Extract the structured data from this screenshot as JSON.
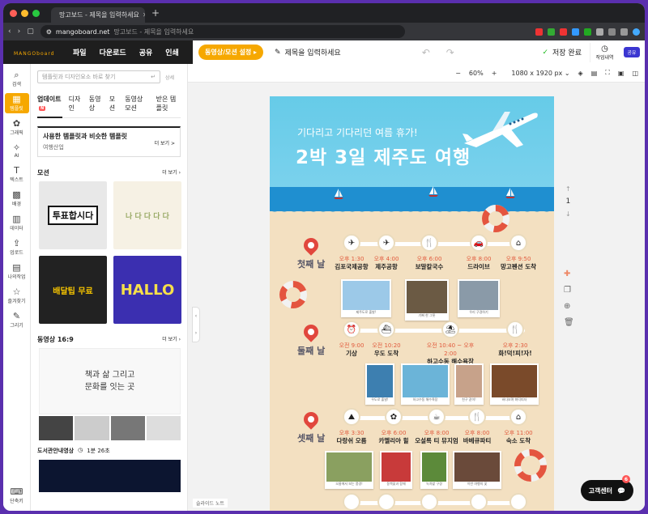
{
  "browser": {
    "tab_title": "망고보드 - 제목을 입력하세요",
    "url_domain": "mangoboard.net",
    "url_rest": "망고보드 - 제목을 입력하세요"
  },
  "header": {
    "logo": "MANGO",
    "logo_sub": "board",
    "menu": [
      "파일",
      "다운로드",
      "공유",
      "인쇄"
    ],
    "video_button": "동영상/모션 설정",
    "title_placeholder": "제목을 입력하세요",
    "saved": "저장 완료",
    "history": "작업내역",
    "share": "공유"
  },
  "rail": [
    {
      "icon": "search-icon",
      "glyph": "⌕",
      "label": "검색"
    },
    {
      "icon": "template-icon",
      "glyph": "▦",
      "label": "템플릿"
    },
    {
      "icon": "graphic-icon",
      "glyph": "✿",
      "label": "그래픽"
    },
    {
      "icon": "ai-icon",
      "glyph": "✧",
      "label": "AI"
    },
    {
      "icon": "text-icon",
      "glyph": "T",
      "label": "텍스트"
    },
    {
      "icon": "background-icon",
      "glyph": "▩",
      "label": "배경"
    },
    {
      "icon": "data-icon",
      "glyph": "▥",
      "label": "데이터"
    },
    {
      "icon": "upload-icon",
      "glyph": "⇪",
      "label": "업로드"
    },
    {
      "icon": "my-work-icon",
      "glyph": "▤",
      "label": "나의작업"
    },
    {
      "icon": "favorite-icon",
      "glyph": "☆",
      "label": "즐겨찾기"
    },
    {
      "icon": "draw-icon",
      "glyph": "✎",
      "label": "그리기"
    }
  ],
  "rail_bottom": "단축키",
  "panel": {
    "search_placeholder": "템플릿과 디자인요소 바로 찾기",
    "search_detail": "상세",
    "tabs": [
      "업데이트",
      "디자인",
      "동영상",
      "모션",
      "동영상 모션",
      "받은 템플릿"
    ],
    "update_badge": "N",
    "recommend_title": "사용한 템플릿과 비슷한 템플릿",
    "recommend_sub": "여행산업",
    "more": "더 보기 >",
    "motion_title": "모션",
    "motion_more": "더 보기",
    "motion_items": [
      "투표합시다",
      "나 다 다 다 다",
      "배달팁 무료",
      "HALLO"
    ],
    "video_title": "동영상 16:9",
    "video_more": "더 보기",
    "video_text1": "책과 삶 그리고",
    "video_text2": "문화를 잇는 곳",
    "clip_title": "도서관안내영상",
    "clip_dur": "1분 26초"
  },
  "toolbar": {
    "zoom": "60%",
    "size": "1080 x 1920 px"
  },
  "canvas": {
    "subtitle": "기다리고 기다리던 여름 휴가!",
    "title": "2박 3일 제주도 여행",
    "days": [
      "첫째 날",
      "둘째 날",
      "셋째 날"
    ],
    "day1": [
      {
        "time": "오후 1:30",
        "name": "김포국제공항"
      },
      {
        "time": "오후 4:00",
        "name": "제주공항"
      },
      {
        "time": "오후 6:00",
        "name": "보말칼국수"
      },
      {
        "time": "오후 8:00",
        "name": "드라이브"
      },
      {
        "time": "오후 9:50",
        "name": "망고펜션 도착"
      }
    ],
    "day2": [
      {
        "time": "오전 9:00",
        "name": "기상"
      },
      {
        "time": "오전 10:20",
        "name": "우도 도착"
      },
      {
        "time": "오전 10:40 ~ 오후 2:00",
        "name": "하고수동 해수욕장"
      },
      {
        "time": "오후 2:30",
        "name": "화!덕!피!자!"
      }
    ],
    "day3": [
      {
        "time": "오후 3:30",
        "name": "다랑쉬 오름"
      },
      {
        "time": "오후 6:00",
        "name": "카멜리아 힐"
      },
      {
        "time": "오후 8:00",
        "name": "오설록 티 뮤지엄"
      },
      {
        "time": "오후 8:00",
        "name": "바베큐파티"
      },
      {
        "time": "오후 11:00",
        "name": "숙소 도착"
      }
    ],
    "captions1": [
      "제주도로 출발!",
      "기뻐 한 그릇",
      "우리 구경하기"
    ],
    "captions2": [
      "우도로 출발!",
      "하고수동 해수욕장",
      "친구 같이!",
      "바다보며 화덕피자"
    ],
    "captions3": [
      "오름에서 보는 풍경!",
      "동백꽃과 함께",
      "녹차밭 구경",
      "이번 여행의 꽃"
    ]
  },
  "pager": {
    "page": "1"
  },
  "slide_note": "슬라이드 노트",
  "support": {
    "label": "고객센터",
    "count": "6"
  }
}
